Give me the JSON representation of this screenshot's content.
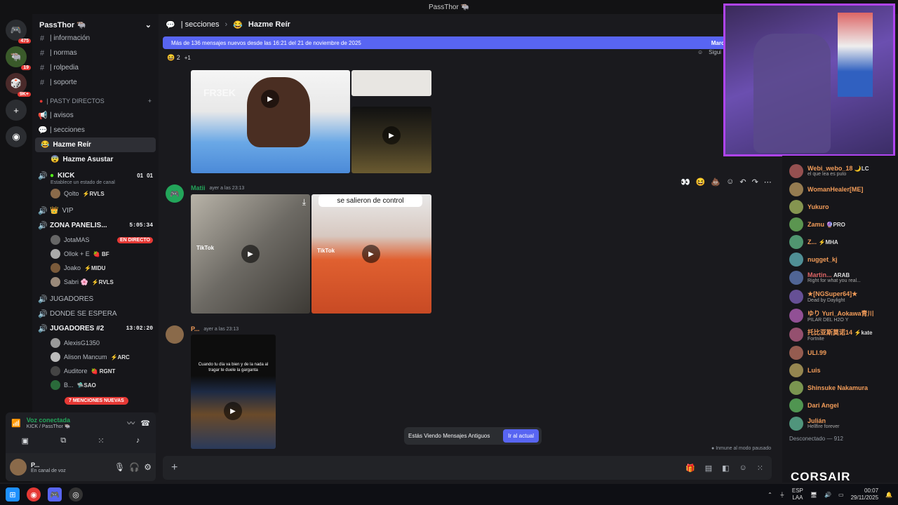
{
  "window": {
    "title": "PassThor 🐃"
  },
  "servers": {
    "badges": [
      "475",
      "19",
      "9K+"
    ]
  },
  "sidebar": {
    "server_name": "PassThor 🐃",
    "channels_top": [
      {
        "icon": "#",
        "emoji": "📒",
        "label": "| información"
      },
      {
        "icon": "#",
        "emoji": "⚠️",
        "label": "| normas"
      },
      {
        "icon": "#",
        "emoji": "📔",
        "label": "| rolpedia"
      },
      {
        "icon": "#",
        "emoji": "🛄",
        "label": "| soporte"
      }
    ],
    "category": "| PASTY DIRECTOS",
    "channels_mid": [
      {
        "emoji": "📢",
        "label": "| avisos"
      },
      {
        "emoji": "🌮",
        "label": "| secciones"
      }
    ],
    "threads": [
      {
        "label": "Hazme Reír",
        "emoji": "😂"
      },
      {
        "label": "Hazme Asustar",
        "emoji": "😨"
      }
    ],
    "voice_kick": {
      "label": "KICK",
      "counts": [
        "01",
        "01"
      ],
      "status": "Establece un estado de canal"
    },
    "kick_user": {
      "name": "Qolto",
      "tag": "⚡RVLS"
    },
    "vip": "VIP",
    "zona": {
      "label": "ZONA PANELIS...",
      "time": "5:05:34"
    },
    "zona_users": [
      {
        "name": "JotaMAS",
        "tag": "",
        "live": "EN DIRECTO"
      },
      {
        "name": "Ollok + E",
        "tag": "🍓 BF",
        "live": ""
      },
      {
        "name": "Joako",
        "tag": "⚡MIDU",
        "live": ""
      },
      {
        "name": "Sabri 🌸",
        "tag": "⚡RVLS",
        "live": ""
      }
    ],
    "jugadores": "JUGADORES",
    "espera": "DONDE SE ESPERA",
    "jugadores2": {
      "label": "JUGADORES #2",
      "time": "13:02:20"
    },
    "j2_users": [
      {
        "name": "AlexisG1350",
        "tag": ""
      },
      {
        "name": "Alison Mancum",
        "tag": "⚡ARC"
      },
      {
        "name": "Auditore",
        "tag": "🍓 RGNT"
      },
      {
        "name": "B...",
        "tag": "🛸SAO"
      }
    ],
    "mentions": "7 MENCIONES NUEVAS"
  },
  "voice": {
    "title": "Voz conectada",
    "subtitle": "KICK / PassThor 🐃"
  },
  "user_panel": {
    "name": "P...",
    "status": "En canal de voz"
  },
  "chat": {
    "breadcrumb": [
      "| secciones",
      "Hazme Reír"
    ],
    "banner": "Más de 136 mensajes nuevos desde las 16:21 del 21 de noviembre de 2025",
    "banner_action": "Marcar",
    "follow": "Sigui",
    "reaction_count": "2",
    "reaction_more": "+1",
    "msg1": {
      "author": "Matii",
      "time": "ayer a las 23:13",
      "caption": "se salieron de control",
      "tiktok": "TikTok"
    },
    "msg2": {
      "author": "P...",
      "time": "ayer a las 23:13",
      "caption": "Cuando tu día va bien y de la nada al tragar te duele la garganta"
    },
    "watermark": "FR3EK",
    "old_label": "Estás Viendo Mensajes Antiguos",
    "old_button": "Ir al actual",
    "immune": "Inmune al modo pausado"
  },
  "members": [
    {
      "name": "Webi_webo_18",
      "sub": "el que lea es puto",
      "tag": "🌙LC",
      "color": "#f29c59"
    },
    {
      "name": "WomanHealer[ME]",
      "sub": "",
      "tag": "",
      "color": "#f29c59"
    },
    {
      "name": "Yukuro",
      "sub": "",
      "tag": "",
      "color": "#f29c59"
    },
    {
      "name": "Zamu",
      "sub": "",
      "tag": "🔮PRO",
      "color": "#f29c59"
    },
    {
      "name": "Z...",
      "sub": "",
      "tag": "⚡MHA",
      "color": "#f29c59"
    },
    {
      "name": "nugget_kj",
      "sub": "",
      "tag": "",
      "color": "#f29c59"
    },
    {
      "name": "Martin...",
      "sub": "Right for what you real...",
      "tag": "ARAB",
      "color": "#e06666"
    },
    {
      "name": "★[NGSuper64]★",
      "sub": "Dead by Daylight",
      "tag": "",
      "color": "#f29c59"
    },
    {
      "name": "ゆり Yuri_Aokawa青川",
      "sub": "PILAR DEL H2O Y",
      "tag": "",
      "color": "#f29c59"
    },
    {
      "name": "托比亚斯莫诺14",
      "sub": "Fortnite",
      "tag": "⚡kate",
      "color": "#f29c59"
    },
    {
      "name": "ULI.99",
      "sub": "",
      "tag": "",
      "color": "#f29c59"
    },
    {
      "name": "Luis",
      "sub": "",
      "tag": "",
      "color": "#f29c59"
    },
    {
      "name": "Shinsuke Nakamura",
      "sub": "",
      "tag": "",
      "color": "#f29c59"
    },
    {
      "name": "Dari Angel",
      "sub": "",
      "tag": "",
      "color": "#f29c59"
    },
    {
      "name": "Julián",
      "sub": "Hellfire forever",
      "tag": "",
      "color": "#f29c59"
    }
  ],
  "disconnected": "Desconectado — 912",
  "brand": "CORSAIR",
  "taskbar": {
    "lang": "ESP",
    "layout": "LAA",
    "time": "00:07",
    "date": "29/11/2025"
  }
}
